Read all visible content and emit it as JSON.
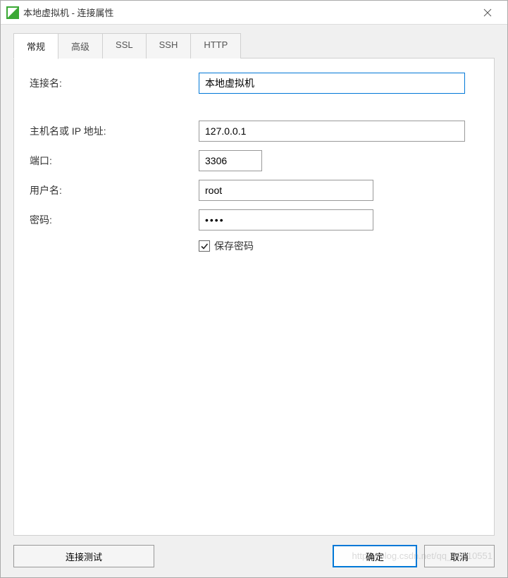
{
  "window": {
    "title": "本地虚拟机 - 连接属性"
  },
  "tabs": [
    {
      "label": "常规",
      "active": true
    },
    {
      "label": "高级",
      "active": false
    },
    {
      "label": "SSL",
      "active": false
    },
    {
      "label": "SSH",
      "active": false
    },
    {
      "label": "HTTP",
      "active": false
    }
  ],
  "form": {
    "conn_name_label": "连接名:",
    "conn_name_value": "本地虚拟机",
    "host_label": "主机名或 IP 地址:",
    "host_value": "127.0.0.1",
    "port_label": "端口:",
    "port_value": "3306",
    "user_label": "用户名:",
    "user_value": "root",
    "pass_label": "密码:",
    "pass_value": "••••",
    "save_pass_checked": true,
    "save_pass_label": "保存密码"
  },
  "buttons": {
    "test": "连接测试",
    "ok": "确定",
    "cancel": "取消"
  },
  "watermark": "https://blog.csdn.net/qq_22310551"
}
